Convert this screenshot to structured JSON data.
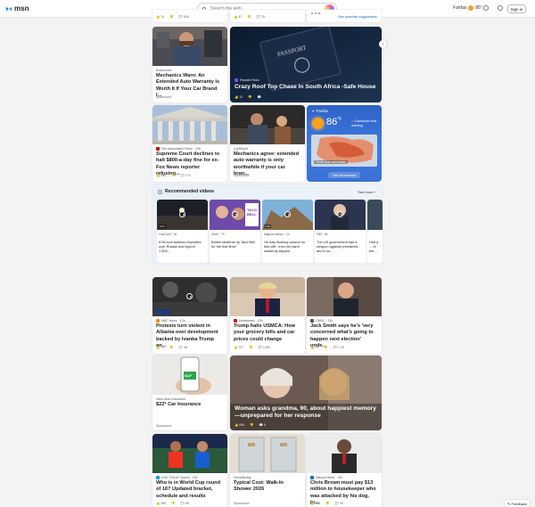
{
  "header": {
    "logo_text": "msn",
    "search_placeholder": "Search the web",
    "location": "Fairfax",
    "temp": "86°",
    "signin_label": "Sign in"
  },
  "top_row": {
    "a_counts": [
      "70",
      "",
      "549"
    ],
    "b_counts": [
      "87",
      "",
      "76"
    ],
    "c_link": "See watchlist suggestions"
  },
  "cards": {
    "warranty": {
      "source": "Endurance",
      "title": "Mechanics Warn: An Extended Auto Warranty Is Worth It If Your Car Brand I...",
      "sponsored": "Sponsored"
    },
    "passport": {
      "source": "Repoint Roku",
      "title": "Crazy Roof Top Chase In South Africa -Safe House",
      "counts": [
        "10",
        ""
      ]
    },
    "scotus": {
      "source": "The Associated Press · 13h",
      "title": "Supreme Court declines to halt $800-a-day fine for ex-Fox News reporter refusing...",
      "counts": [
        "896",
        "",
        "170"
      ]
    },
    "mechanics": {
      "source": "CarShield",
      "title": "Mechanics agree: extended auto warranty is only worthwhile if your car bran...",
      "sponsored": "Sponsored"
    },
    "albania": {
      "source": "NBC News · 13h",
      "title": "Protests turn violent in Albania over development backed by Ivanka Trump an...",
      "counts": [
        "74",
        "",
        "48"
      ]
    },
    "usmca": {
      "source": "Newsweek · 22h",
      "title": "Trump halts USMCA: How your grocery bills and car prices could change",
      "counts": [
        "707",
        "",
        "1390"
      ]
    },
    "jacksmith": {
      "source": "CNBC · 13h",
      "title": "Jack Smith says he's 'very concerned what's going to happen next election' unde...",
      "counts": [
        "74",
        "",
        "1.2K"
      ]
    },
    "insurance": {
      "source": "Save Auto Insurance",
      "title": "$22* Car Insurance",
      "sponsored": "Sponsored",
      "badge": "$22*"
    },
    "grandma": {
      "title": "Woman asks grandma, 90, about happiest memory—unprepared for her response",
      "counts": [
        "696",
        "",
        "6"
      ]
    },
    "worldcup": {
      "source": "USA TODAY Sports · 13h",
      "title": "Who is in World Cup round of 16? Updated bracket, schedule and results",
      "counts": [
        "285",
        "",
        "95"
      ]
    },
    "shower": {
      "source": "HomeBuddy",
      "title": "Typical Cost: Walk-In Shower 2026",
      "sponsored": "Sponsored"
    },
    "chrisbrown": {
      "source": "Satoya News · 13h",
      "title": "Chris Brown must pay $13 million to housekeeper who was attacked by his dog, ju...",
      "counts": [
        "168",
        "",
        "99"
      ]
    }
  },
  "weather": {
    "location": "Fairfax",
    "temp": "86",
    "unit": "°F",
    "alert": "Excessive heat warning",
    "map_label": "Check more alert details",
    "forecast_btn": "See full forecast"
  },
  "recommended": {
    "heading": "Recommended videos",
    "see_more": "See more",
    "videos": [
      {
        "source": "Vindi.com · 3d",
        "title": "A 60-foot asteroid exploded over Russia and injured 1,500...",
        "duration": "0:41"
      },
      {
        "source": "USA3 · 7h",
        "title": "British students try Taco Bell for the first time!",
        "duration": "",
        "badge": "TACO BELL"
      },
      {
        "source": "Magnus Mahoo · 1d",
        "title": "He was flushing around on this cliff - then his hand suddenly slipped",
        "duration": "1:42"
      },
      {
        "source": "FBS · 8h",
        "title": "The US government has a weapon against presidents - and it ca...",
        "duration": ""
      },
      {
        "source": "",
        "title": "Half a ... of the...",
        "duration": ""
      }
    ]
  },
  "colors": {
    "accent": "#0f6cbd",
    "weather_bg": "#3d7be0",
    "alert": "#e05a2a"
  },
  "feedback_label": "Feedback"
}
